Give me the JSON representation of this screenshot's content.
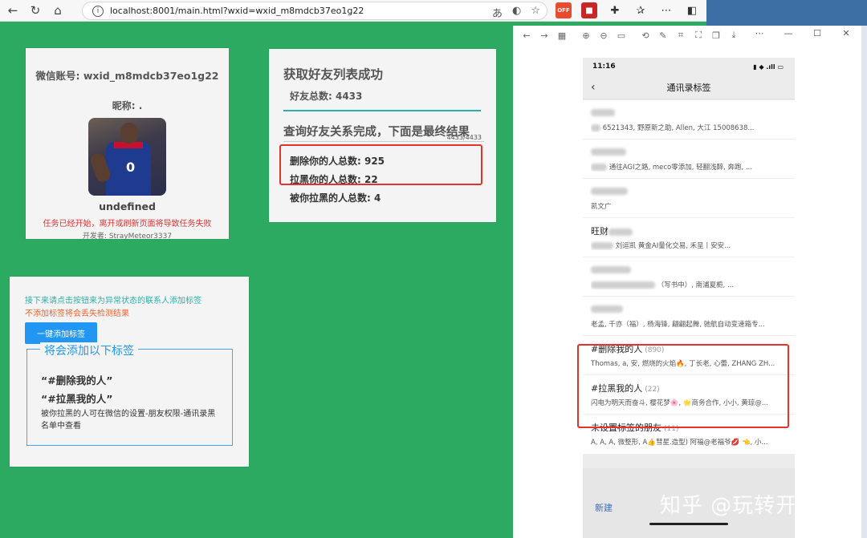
{
  "browser": {
    "url": "localhost:8001/main.html?wxid=wxid_m8mdcb37eo1g22",
    "ext_off_label": "OFF"
  },
  "profile": {
    "account": "微信账号: wxid_m8mdcb37eo1g22",
    "nickname": "昵称: .",
    "jersey_number": "0",
    "name": "undefined",
    "warning": "任务已经开始，离开或刷新页面将导致任务失败",
    "developer": "开发者: StrayMeteor3337"
  },
  "result": {
    "title": "获取好友列表成功",
    "friends_total": "好友总数: 4433",
    "query_done": "查询好友关系完成，下面是最终结果",
    "progress": "4433/4433",
    "deleted": "删除你的人总数: 925",
    "blocked": "拉黑你的人总数: 22",
    "blocked_by_you": "被你拉黑的人总数: 4"
  },
  "tagging": {
    "hint1": "接下来请点击按钮来为异常状态的联系人添加标签",
    "hint2": "不添加标签将会丢失检测结果",
    "button": "一键添加标签",
    "legend": "将会添加以下标签",
    "tag1": "“#删除我的人”",
    "tag2": "“#拉黑我的人”",
    "note": "被你拉黑的人可在微信的设置-朋友权限-通讯录黑名单中查看"
  },
  "phone": {
    "time": "11:16",
    "status_right": "▮ ◆ .ıll ▭",
    "title": "通讯录标签",
    "items": [
      {
        "name": "",
        "count": "",
        "members": "6521343, 野原新之助, Allen, 大江 15008638..."
      },
      {
        "name": "",
        "count": "",
        "members": "通往AGI之路, meco零添加, 轻翻浅醉, 奔跑, ..."
      },
      {
        "name": "",
        "count": "",
        "members": "凯文广"
      },
      {
        "name": "旺财",
        "count": "",
        "members": "刘运凯 黄金AI量化交易, 禾呈丨安安..."
      },
      {
        "name": "",
        "count": "",
        "members": "（写书中）, 南浦夏栀, ..."
      },
      {
        "name": "",
        "count": "",
        "members": "老孟, 千亦（福）, 杨海锋, 翩翩起舞, 驰航自动变速箱专..."
      },
      {
        "name": "#删除我的人",
        "count": "(890)",
        "members": "Thomas, a, 安, 燃烧的火焰🔥, 丁长老, 心蕾, ZHANG ZH..."
      },
      {
        "name": "#拉黑我的人",
        "count": "(22)",
        "members": "闪电为明天而奋斗, 樱花梦🌸, 🌟商务合作, 小小, 黄琼@..."
      },
      {
        "name": "未设置标签的朋友",
        "count": "(11)",
        "members": "A, A, A, 微整形, A👍彗星.造型) 阿福@老福爷💋 👈, 小..."
      }
    ],
    "new_label": "新建"
  },
  "watermark": "知乎 @玩转开源"
}
